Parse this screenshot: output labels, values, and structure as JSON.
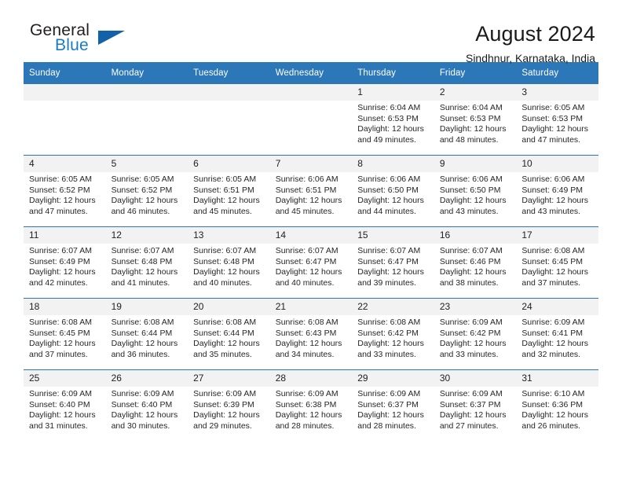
{
  "brand": {
    "name_top": "General",
    "name_bottom": "Blue",
    "accent_color": "#1a7bc4",
    "triangle_color": "#1361a8"
  },
  "header": {
    "title": "August 2024",
    "subtitle": "Sindhnur, Karnataka, India"
  },
  "theme": {
    "header_blue": "#2b77b8",
    "daynum_bg": "#f2f2f2"
  },
  "weekdays": [
    "Sunday",
    "Monday",
    "Tuesday",
    "Wednesday",
    "Thursday",
    "Friday",
    "Saturday"
  ],
  "labels": {
    "sunrise": "Sunrise:",
    "sunset": "Sunset:",
    "daylight": "Daylight:"
  },
  "weeks": [
    [
      {
        "day": "",
        "blank": true
      },
      {
        "day": "",
        "blank": true
      },
      {
        "day": "",
        "blank": true
      },
      {
        "day": "",
        "blank": true
      },
      {
        "day": "1",
        "sunrise": "Sunrise: 6:04 AM",
        "sunset": "Sunset: 6:53 PM",
        "daylight_1": "Daylight: 12 hours",
        "daylight_2": "and 49 minutes."
      },
      {
        "day": "2",
        "sunrise": "Sunrise: 6:04 AM",
        "sunset": "Sunset: 6:53 PM",
        "daylight_1": "Daylight: 12 hours",
        "daylight_2": "and 48 minutes."
      },
      {
        "day": "3",
        "sunrise": "Sunrise: 6:05 AM",
        "sunset": "Sunset: 6:53 PM",
        "daylight_1": "Daylight: 12 hours",
        "daylight_2": "and 47 minutes."
      }
    ],
    [
      {
        "day": "4",
        "sunrise": "Sunrise: 6:05 AM",
        "sunset": "Sunset: 6:52 PM",
        "daylight_1": "Daylight: 12 hours",
        "daylight_2": "and 47 minutes."
      },
      {
        "day": "5",
        "sunrise": "Sunrise: 6:05 AM",
        "sunset": "Sunset: 6:52 PM",
        "daylight_1": "Daylight: 12 hours",
        "daylight_2": "and 46 minutes."
      },
      {
        "day": "6",
        "sunrise": "Sunrise: 6:05 AM",
        "sunset": "Sunset: 6:51 PM",
        "daylight_1": "Daylight: 12 hours",
        "daylight_2": "and 45 minutes."
      },
      {
        "day": "7",
        "sunrise": "Sunrise: 6:06 AM",
        "sunset": "Sunset: 6:51 PM",
        "daylight_1": "Daylight: 12 hours",
        "daylight_2": "and 45 minutes."
      },
      {
        "day": "8",
        "sunrise": "Sunrise: 6:06 AM",
        "sunset": "Sunset: 6:50 PM",
        "daylight_1": "Daylight: 12 hours",
        "daylight_2": "and 44 minutes."
      },
      {
        "day": "9",
        "sunrise": "Sunrise: 6:06 AM",
        "sunset": "Sunset: 6:50 PM",
        "daylight_1": "Daylight: 12 hours",
        "daylight_2": "and 43 minutes."
      },
      {
        "day": "10",
        "sunrise": "Sunrise: 6:06 AM",
        "sunset": "Sunset: 6:49 PM",
        "daylight_1": "Daylight: 12 hours",
        "daylight_2": "and 43 minutes."
      }
    ],
    [
      {
        "day": "11",
        "sunrise": "Sunrise: 6:07 AM",
        "sunset": "Sunset: 6:49 PM",
        "daylight_1": "Daylight: 12 hours",
        "daylight_2": "and 42 minutes."
      },
      {
        "day": "12",
        "sunrise": "Sunrise: 6:07 AM",
        "sunset": "Sunset: 6:48 PM",
        "daylight_1": "Daylight: 12 hours",
        "daylight_2": "and 41 minutes."
      },
      {
        "day": "13",
        "sunrise": "Sunrise: 6:07 AM",
        "sunset": "Sunset: 6:48 PM",
        "daylight_1": "Daylight: 12 hours",
        "daylight_2": "and 40 minutes."
      },
      {
        "day": "14",
        "sunrise": "Sunrise: 6:07 AM",
        "sunset": "Sunset: 6:47 PM",
        "daylight_1": "Daylight: 12 hours",
        "daylight_2": "and 40 minutes."
      },
      {
        "day": "15",
        "sunrise": "Sunrise: 6:07 AM",
        "sunset": "Sunset: 6:47 PM",
        "daylight_1": "Daylight: 12 hours",
        "daylight_2": "and 39 minutes."
      },
      {
        "day": "16",
        "sunrise": "Sunrise: 6:07 AM",
        "sunset": "Sunset: 6:46 PM",
        "daylight_1": "Daylight: 12 hours",
        "daylight_2": "and 38 minutes."
      },
      {
        "day": "17",
        "sunrise": "Sunrise: 6:08 AM",
        "sunset": "Sunset: 6:45 PM",
        "daylight_1": "Daylight: 12 hours",
        "daylight_2": "and 37 minutes."
      }
    ],
    [
      {
        "day": "18",
        "sunrise": "Sunrise: 6:08 AM",
        "sunset": "Sunset: 6:45 PM",
        "daylight_1": "Daylight: 12 hours",
        "daylight_2": "and 37 minutes."
      },
      {
        "day": "19",
        "sunrise": "Sunrise: 6:08 AM",
        "sunset": "Sunset: 6:44 PM",
        "daylight_1": "Daylight: 12 hours",
        "daylight_2": "and 36 minutes."
      },
      {
        "day": "20",
        "sunrise": "Sunrise: 6:08 AM",
        "sunset": "Sunset: 6:44 PM",
        "daylight_1": "Daylight: 12 hours",
        "daylight_2": "and 35 minutes."
      },
      {
        "day": "21",
        "sunrise": "Sunrise: 6:08 AM",
        "sunset": "Sunset: 6:43 PM",
        "daylight_1": "Daylight: 12 hours",
        "daylight_2": "and 34 minutes."
      },
      {
        "day": "22",
        "sunrise": "Sunrise: 6:08 AM",
        "sunset": "Sunset: 6:42 PM",
        "daylight_1": "Daylight: 12 hours",
        "daylight_2": "and 33 minutes."
      },
      {
        "day": "23",
        "sunrise": "Sunrise: 6:09 AM",
        "sunset": "Sunset: 6:42 PM",
        "daylight_1": "Daylight: 12 hours",
        "daylight_2": "and 33 minutes."
      },
      {
        "day": "24",
        "sunrise": "Sunrise: 6:09 AM",
        "sunset": "Sunset: 6:41 PM",
        "daylight_1": "Daylight: 12 hours",
        "daylight_2": "and 32 minutes."
      }
    ],
    [
      {
        "day": "25",
        "sunrise": "Sunrise: 6:09 AM",
        "sunset": "Sunset: 6:40 PM",
        "daylight_1": "Daylight: 12 hours",
        "daylight_2": "and 31 minutes."
      },
      {
        "day": "26",
        "sunrise": "Sunrise: 6:09 AM",
        "sunset": "Sunset: 6:40 PM",
        "daylight_1": "Daylight: 12 hours",
        "daylight_2": "and 30 minutes."
      },
      {
        "day": "27",
        "sunrise": "Sunrise: 6:09 AM",
        "sunset": "Sunset: 6:39 PM",
        "daylight_1": "Daylight: 12 hours",
        "daylight_2": "and 29 minutes."
      },
      {
        "day": "28",
        "sunrise": "Sunrise: 6:09 AM",
        "sunset": "Sunset: 6:38 PM",
        "daylight_1": "Daylight: 12 hours",
        "daylight_2": "and 28 minutes."
      },
      {
        "day": "29",
        "sunrise": "Sunrise: 6:09 AM",
        "sunset": "Sunset: 6:37 PM",
        "daylight_1": "Daylight: 12 hours",
        "daylight_2": "and 28 minutes."
      },
      {
        "day": "30",
        "sunrise": "Sunrise: 6:09 AM",
        "sunset": "Sunset: 6:37 PM",
        "daylight_1": "Daylight: 12 hours",
        "daylight_2": "and 27 minutes."
      },
      {
        "day": "31",
        "sunrise": "Sunrise: 6:10 AM",
        "sunset": "Sunset: 6:36 PM",
        "daylight_1": "Daylight: 12 hours",
        "daylight_2": "and 26 minutes."
      }
    ]
  ]
}
